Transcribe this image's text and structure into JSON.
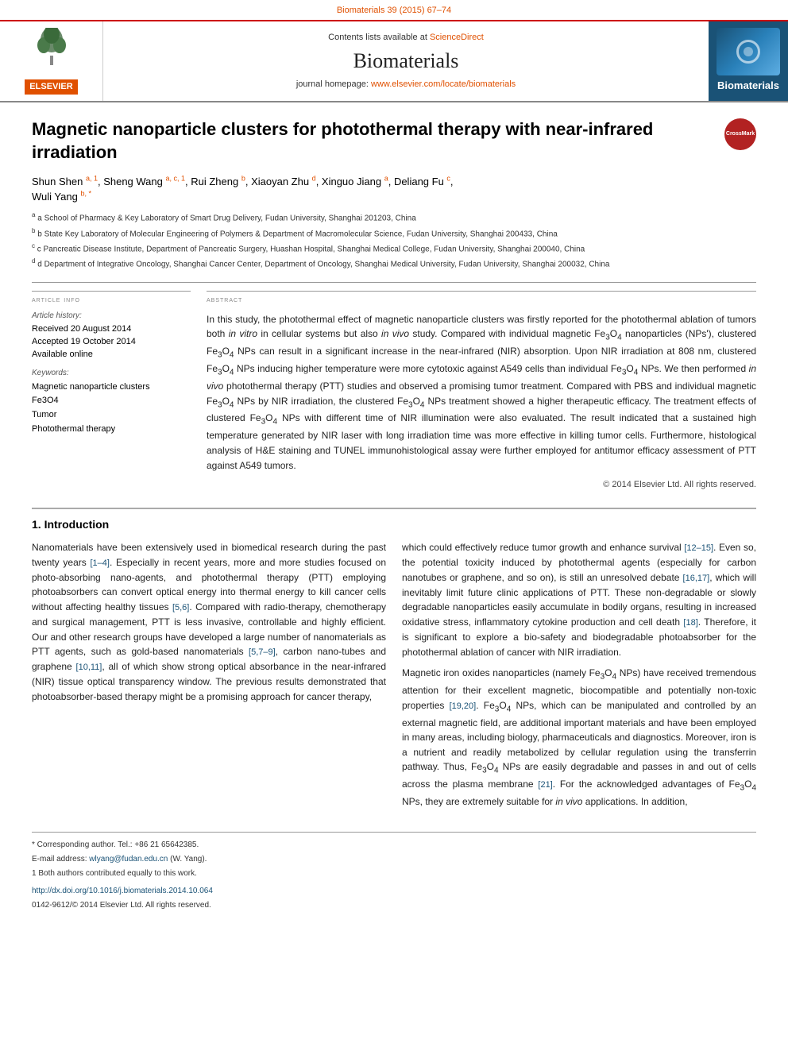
{
  "topBar": {
    "text": "Biomaterials 39 (2015) 67–74"
  },
  "header": {
    "scidirectText": "Contents lists available at",
    "scidirectLink": "ScienceDirect",
    "journalName": "Biomaterials",
    "homepageLabel": "journal homepage:",
    "homepageUrl": "www.elsevier.com/locate/biomaterials",
    "logoLabel": "Biomaterials",
    "elsevier": "ELSEVIER"
  },
  "article": {
    "title": "Magnetic nanoparticle clusters for photothermal therapy with near-infrared irradiation",
    "crossmark": "CrossMark",
    "authors": "Shun Shen a, 1, Sheng Wang a, c, 1, Rui Zheng b, Xiaoyan Zhu d, Xinguo Jiang a, Deliang Fu c, Wuli Yang b, *",
    "affiliations": [
      "a School of Pharmacy & Key Laboratory of Smart Drug Delivery, Fudan University, Shanghai 201203, China",
      "b State Key Laboratory of Molecular Engineering of Polymers & Department of Macromolecular Science, Fudan University, Shanghai 200433, China",
      "c Pancreatic Disease Institute, Department of Pancreatic Surgery, Huashan Hospital, Shanghai Medical College, Fudan University, Shanghai 200040, China",
      "d Department of Integrative Oncology, Shanghai Cancer Center, Department of Oncology, Shanghai Medical University, Fudan University, Shanghai 200032, China"
    ],
    "articleInfoTitle": "article info",
    "articleHistoryLabel": "Article history:",
    "received": "Received 20 August 2014",
    "accepted": "Accepted 19 October 2014",
    "availableOnline": "Available online",
    "keywordsLabel": "Keywords:",
    "keywords": [
      "Magnetic nanoparticle clusters",
      "Fe3O4",
      "Tumor",
      "Photothermal therapy"
    ],
    "abstractTitle": "abstract",
    "abstractText": "In this study, the photothermal effect of magnetic nanoparticle clusters was firstly reported for the photothermal ablation of tumors both in vitro in cellular systems but also in vivo study. Compared with individual magnetic Fe3O4 nanoparticles (NPs'), clustered Fe3O4 NPs can result in a significant increase in the near-infrared (NIR) absorption. Upon NIR irradiation at 808 nm, clustered Fe3O4 NPs inducing higher temperature were more cytotoxic against A549 cells than individual Fe3O4 NPs. We then performed in vivo photothermal therapy (PTT) studies and observed a promising tumor treatment. Compared with PBS and individual magnetic Fe3O4 NPs by NIR irradiation, the clustered Fe3O4 NPs treatment showed a higher therapeutic efficacy. The treatment effects of clustered Fe3O4 NPs with different time of NIR illumination were also evaluated. The result indicated that a sustained high temperature generated by NIR laser with long irradiation time was more effective in killing tumor cells. Furthermore, histological analysis of H&E staining and TUNEL immunohistological assay were further employed for antitumor efficacy assessment of PTT against A549 tumors.",
    "copyright": "© 2014 Elsevier Ltd. All rights reserved."
  },
  "introduction": {
    "sectionNumber": "1.",
    "sectionTitle": "Introduction",
    "col1": {
      "para1": "Nanomaterials have been extensively used in biomedical research during the past twenty years [1–4]. Especially in recent years, more and more studies focused on photo-absorbing nano-agents, and photothermal therapy (PTT) employing photoabsorbers can convert optical energy into thermal energy to kill cancer cells without affecting healthy tissues [5,6]. Compared with radio-therapy, chemotherapy and surgical management, PTT is less invasive, controllable and highly efficient. Our and other research groups have developed a large number of nanomaterials as PTT agents, such as gold-based nanomaterials [5,7–9], carbon nano-tubes and graphene [10,11], all of which show strong optical absorbance in the near-infrared (NIR) tissue optical transparency window. The previous results demonstrated that photoabsorber-based therapy might be a promising approach for cancer therapy,"
    },
    "col2": {
      "para1": "which could effectively reduce tumor growth and enhance survival [12–15]. Even so, the potential toxicity induced by photothermal agents (especially for carbon nanotubes or graphene, and so on), is still an unresolved debate [16,17], which will inevitably limit future clinic applications of PTT. These non-degradable or slowly degradable nanoparticles easily accumulate in bodily organs, resulting in increased oxidative stress, inflammatory cytokine production and cell death [18]. Therefore, it is significant to explore a bio-safety and biodegradable photoabsorber for the photothermal ablation of cancer with NIR irradiation.",
      "para2": "Magnetic iron oxides nanoparticles (namely Fe3O4 NPs) have received tremendous attention for their excellent magnetic, biocompatible and potentially non-toxic properties [19,20]. Fe3O4 NPs, which can be manipulated and controlled by an external magnetic field, are additional important materials and have been employed in many areas, including biology, pharmaceuticals and diagnostics. Moreover, iron is a nutrient and readily metabolized by cellular regulation using the transferrin pathway. Thus, Fe3O4 NPs are easily degradable and passes in and out of cells across the plasma membrane [21]. For the acknowledged advantages of Fe3O4 NPs, they are extremely suitable for in vivo applications. In addition,"
    }
  },
  "footer": {
    "correspondingNote": "* Corresponding author. Tel.: +86 21 65642385.",
    "emailLabel": "E-mail address:",
    "emailAddress": "wlyang@fudan.edu.cn",
    "emailPerson": "(W. Yang).",
    "footnote1": "1 Both authors contributed equally to this work.",
    "doiLine": "http://dx.doi.org/10.1016/j.biomaterials.2014.10.064",
    "issnLine": "0142-9612/© 2014 Elsevier Ltd. All rights reserved."
  }
}
